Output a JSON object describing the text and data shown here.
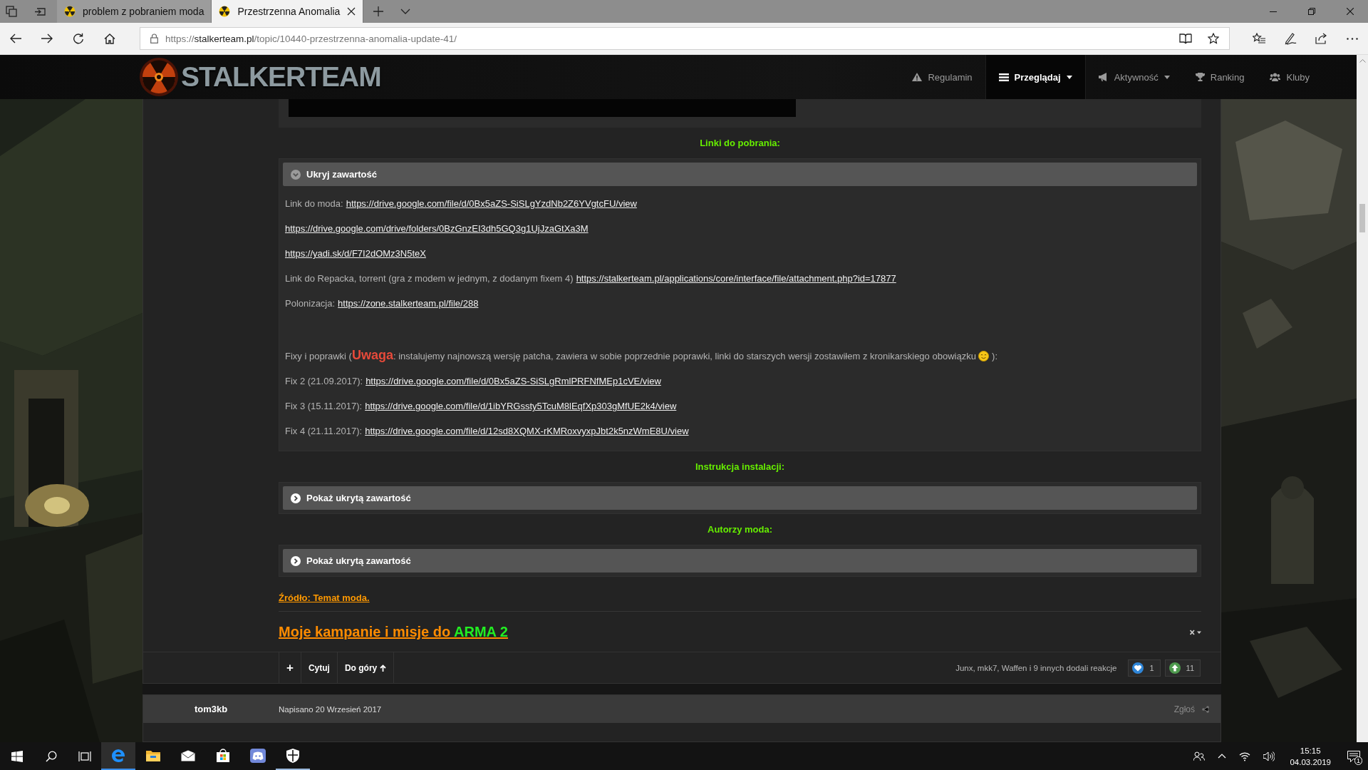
{
  "browser": {
    "tabs": [
      {
        "title": "problem z pobraniem moda",
        "selected": false
      },
      {
        "title": "Przestrzenna Anomalia",
        "selected": true
      }
    ],
    "url": {
      "scheme": "https://",
      "host": "stalkerteam.pl",
      "path": "/topic/10440-przestrzenna-anomalia-update-41/"
    }
  },
  "site": {
    "logo_text": "STALKERTEAM",
    "nav": [
      {
        "label": "Regulamin",
        "selected": false,
        "dropdown": false
      },
      {
        "label": "Przeglądaj",
        "selected": true,
        "dropdown": true
      },
      {
        "label": "Aktywność",
        "selected": false,
        "dropdown": true
      },
      {
        "label": "Ranking",
        "selected": false,
        "dropdown": false
      },
      {
        "label": "Kluby",
        "selected": false,
        "dropdown": false
      }
    ]
  },
  "post": {
    "blocks": [
      {
        "kind": "media"
      },
      {
        "kind": "heading",
        "text": "Linki do pobrania:"
      },
      {
        "kind": "spoiler",
        "title": "Ukryj zawartość",
        "expanded": true,
        "lines": [
          {
            "kind": "link",
            "label": "Link do moda:",
            "url": "https://drive.google.com/file/d/0Bx5aZS-SiSLgYzdNb2Z6YVgtcFU/view"
          },
          {
            "kind": "link",
            "url": "https://drive.google.com/drive/folders/0BzGnzEI3dh5GQ3g1UjJzaGtXa3M"
          },
          {
            "kind": "link",
            "url": "https://yadi.sk/d/F7I2dOMz3N5teX"
          },
          {
            "kind": "link",
            "label": "Link do Repacka, torrent (gra z modem w jednym, z dodanym fixem 4)",
            "url": "https://stalkerteam.pl/applications/core/interface/file/attachment.php?id=17877"
          },
          {
            "kind": "link",
            "label": "Polonizacja:",
            "url": "https://zone.stalkerteam.pl/file/288"
          },
          {
            "kind": "note",
            "before": "Fixy i poprawki (",
            "warning": "Uwaga",
            "after": ": instalujemy najnowszą wersję patcha, zawiera w sobie poprzednie poprawki, linki do starszych wersji zostawiłem z kronikarskiego obowiązku",
            "end": "):"
          },
          {
            "kind": "link",
            "label": "Fix 2 (21.09.2017):",
            "url": "https://drive.google.com/file/d/0Bx5aZS-SiSLgRmlPRFNfMEp1cVE/view"
          },
          {
            "kind": "link",
            "label": "Fix 3 (15.11.2017):",
            "url": "https://drive.google.com/file/d/1ibYRGssty5TcuM8lEqfXp303gMfUE2k4/view"
          },
          {
            "kind": "link",
            "label": "Fix 4 (21.11.2017):",
            "url": "https://drive.google.com/file/d/12sd8XQMX-rKMRoxvyxpJbt2k5nzWmE8U/view"
          }
        ]
      },
      {
        "kind": "heading",
        "text": "Instrukcja instalacji:"
      },
      {
        "kind": "spoiler",
        "title": "Pokaż ukrytą zawartość",
        "expanded": false
      },
      {
        "kind": "heading",
        "text": "Autorzy moda:"
      },
      {
        "kind": "spoiler",
        "title": "Pokaż ukrytą zawartość",
        "expanded": false
      },
      {
        "kind": "source",
        "text": "Źródło: Temat moda."
      },
      {
        "kind": "signature",
        "text": "Moje kampanie i misje do",
        "highlight": "ARMA 2"
      }
    ],
    "actions": [
      {
        "kind": "multiquote",
        "label": "+"
      },
      {
        "kind": "quote",
        "label": "Cytuj"
      },
      {
        "kind": "top",
        "label": "Do góry"
      }
    ],
    "reactions_text": "Junx, mkk7, Waffen i 9 innych dodali reakcje",
    "reactions": [
      {
        "count": "1",
        "color": "#2f86d8"
      },
      {
        "count": "11",
        "color": "#4e9a4e"
      }
    ]
  },
  "next_post": {
    "author": "tom3kb",
    "date": "Napisano 20 Wrzesień 2017",
    "report": "Zgłoś"
  },
  "taskbar": {
    "apps": [
      {
        "selected": true,
        "running": true
      },
      {
        "selected": false,
        "running": false
      },
      {
        "selected": false,
        "running": false
      },
      {
        "selected": false,
        "running": false
      },
      {
        "selected": false,
        "running": false
      },
      {
        "selected": false,
        "running": true
      }
    ],
    "time": "15:15",
    "date": "04.03.2019",
    "notifications": "1"
  }
}
